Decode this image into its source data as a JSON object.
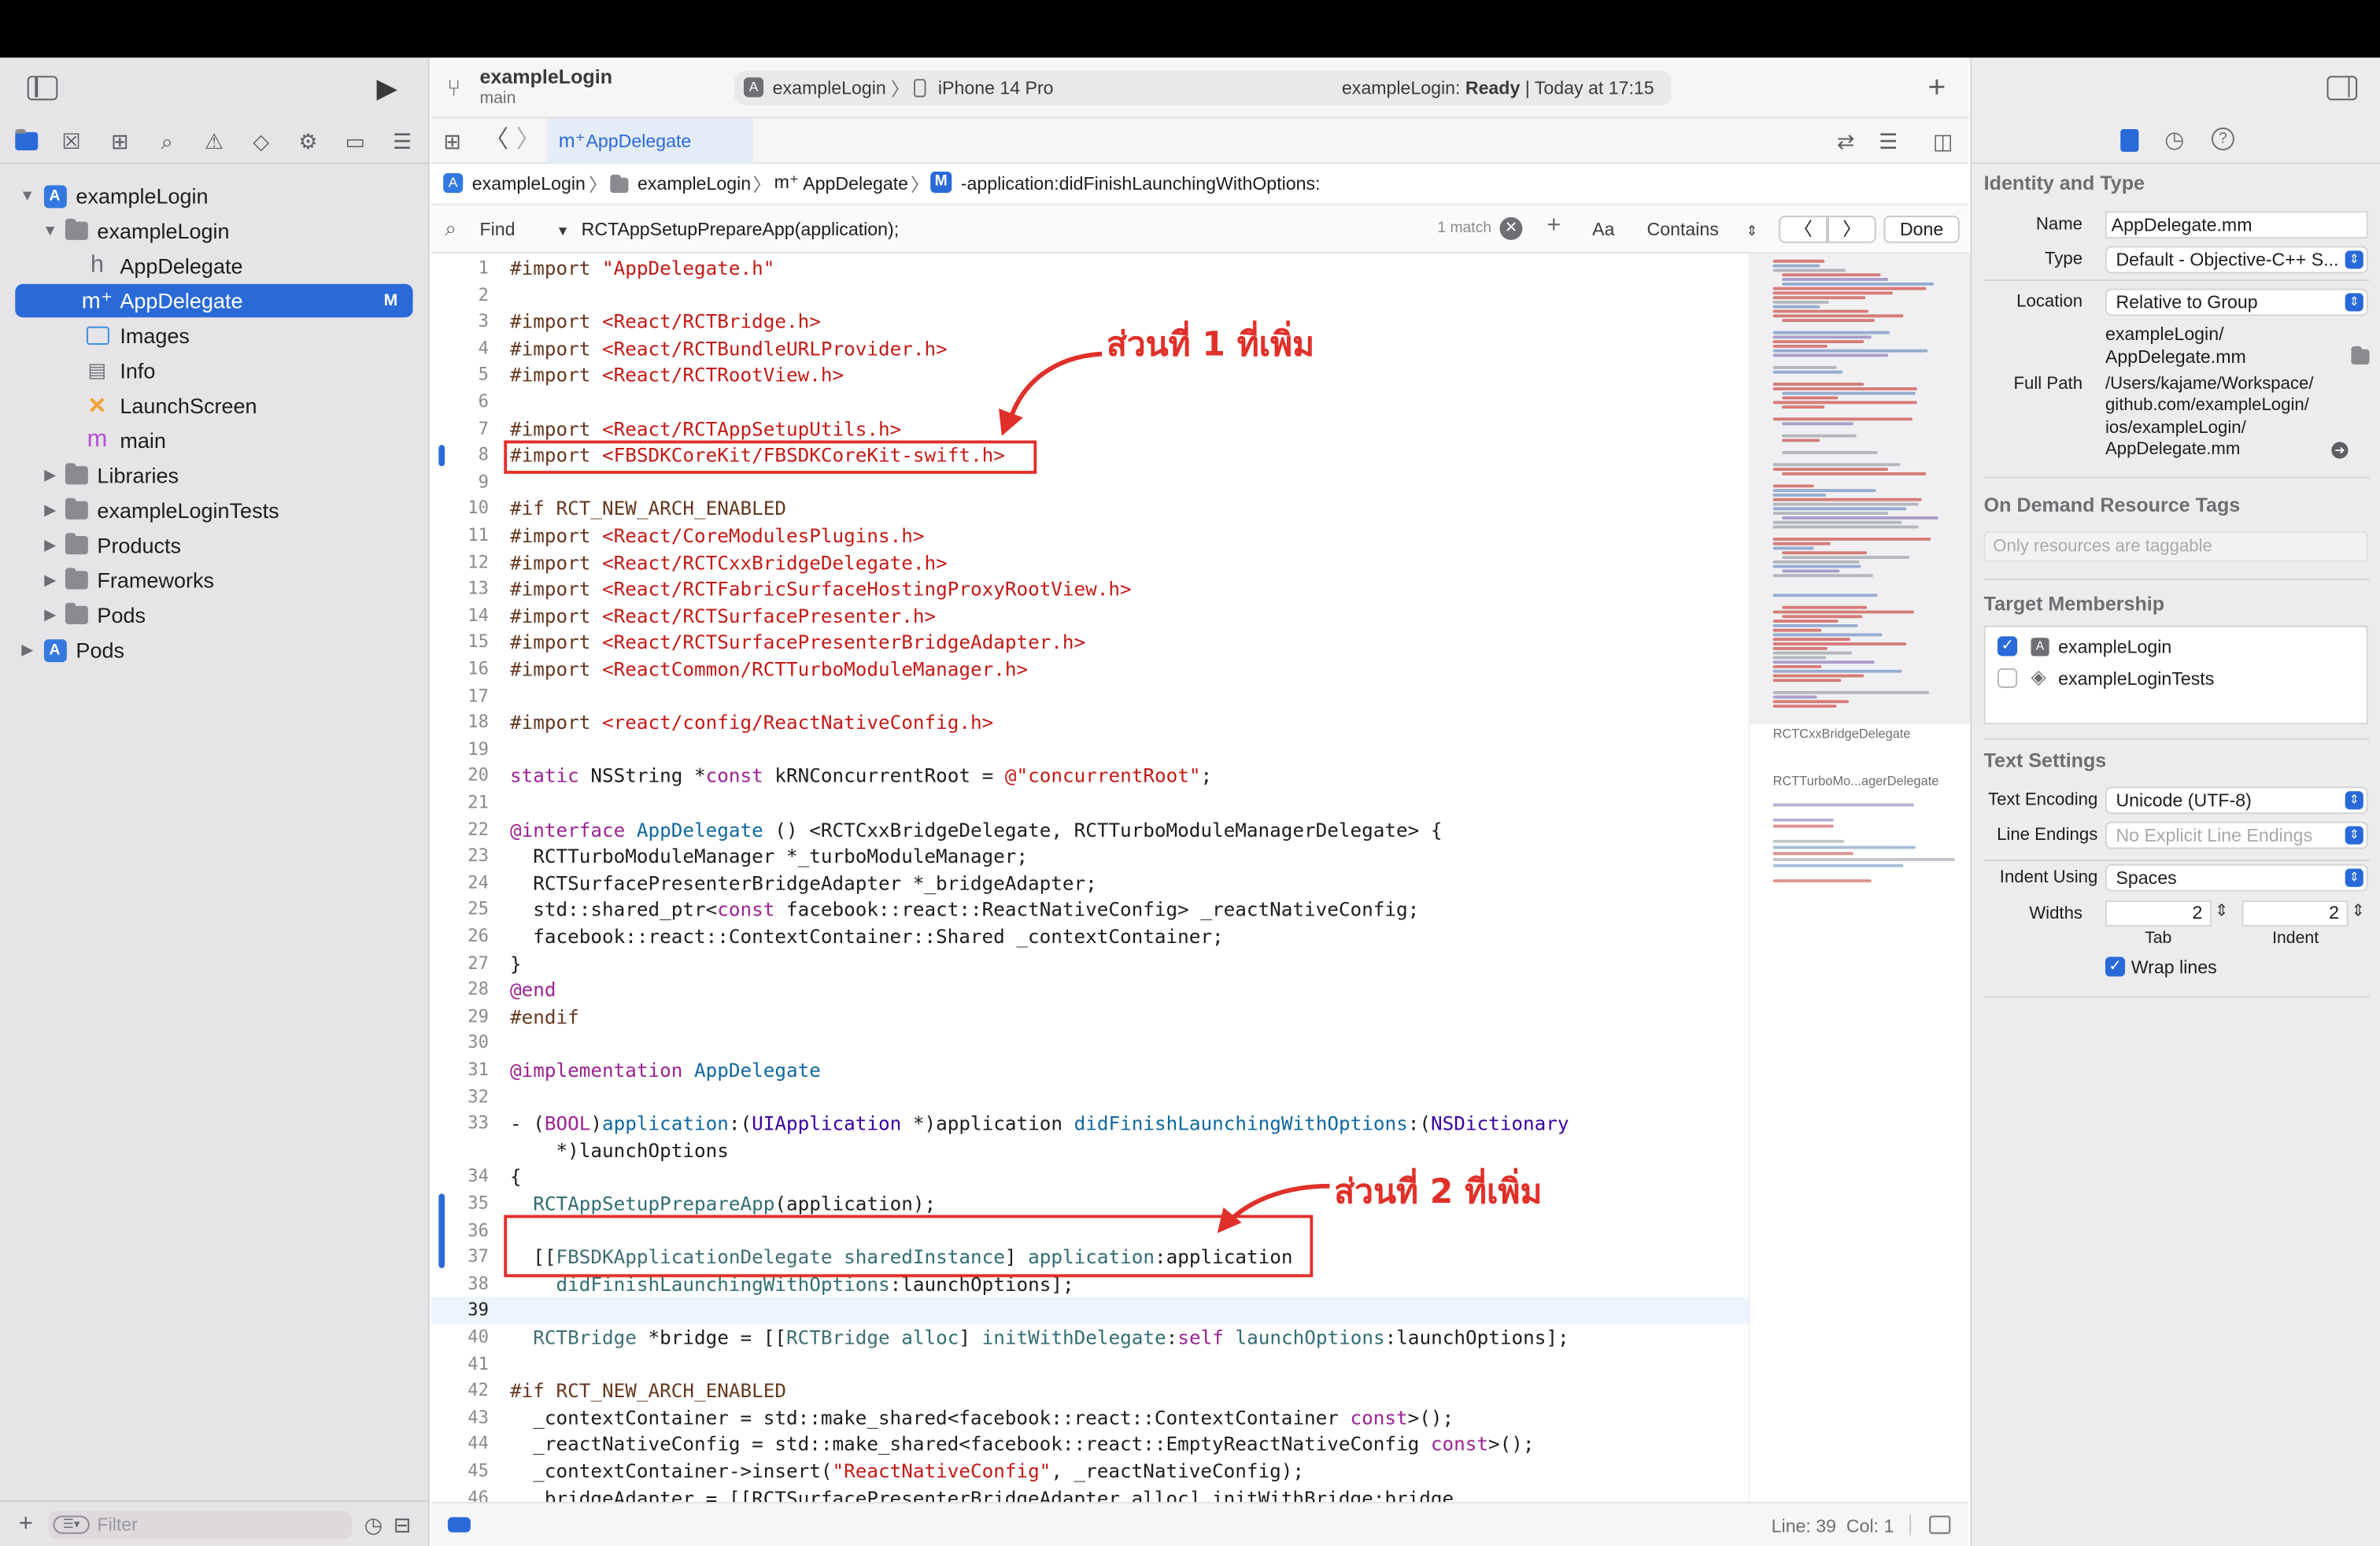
{
  "project": {
    "name": "exampleLogin",
    "branch": "main"
  },
  "toolbar": {
    "scheme": "exampleLogin",
    "device": "iPhone 14 Pro",
    "status_prefix": "exampleLogin: ",
    "status_state": "Ready",
    "status_time": " | Today at 17:15"
  },
  "navigator": {
    "items": [
      {
        "label": "exampleLogin",
        "kind": "project"
      },
      {
        "label": "exampleLogin",
        "kind": "folder"
      },
      {
        "label": "AppDelegate",
        "kind": "header-file",
        "icon_glyph": "h"
      },
      {
        "label": "AppDelegate",
        "kind": "objc-file",
        "icon_glyph": "m⁺",
        "badge": "M"
      },
      {
        "label": "Images",
        "kind": "assets"
      },
      {
        "label": "Info",
        "kind": "plist"
      },
      {
        "label": "LaunchScreen",
        "kind": "storyboard",
        "icon_glyph": "✕"
      },
      {
        "label": "main",
        "kind": "objc-file",
        "icon_glyph": "m"
      },
      {
        "label": "Libraries",
        "kind": "folder"
      },
      {
        "label": "exampleLoginTests",
        "kind": "folder"
      },
      {
        "label": "Products",
        "kind": "folder"
      },
      {
        "label": "Frameworks",
        "kind": "folder"
      },
      {
        "label": "Pods",
        "kind": "folder"
      },
      {
        "label": "Pods",
        "kind": "project"
      }
    ],
    "filter_placeholder": "Filter"
  },
  "tab": {
    "label": "AppDelegate"
  },
  "jumpbar": {
    "items": [
      "exampleLogin",
      "exampleLogin",
      "AppDelegate",
      "-application:didFinishLaunchingWithOptions:"
    ]
  },
  "find": {
    "mode": "Find",
    "query": "RCTAppSetupPrepareApp(application);",
    "matches": "1 match",
    "case_label": "Aa",
    "match_mode": "Contains",
    "done_label": "Done"
  },
  "code": {
    "lines": [
      {
        "n": "1",
        "html": "<span class='p'>#import</span> <span class='s'>\"AppDelegate.h\"</span>"
      },
      {
        "n": "2",
        "html": ""
      },
      {
        "n": "3",
        "html": "<span class='p'>#import</span> <span class='s'>&lt;React/RCTBridge.h&gt;</span>"
      },
      {
        "n": "4",
        "html": "<span class='p'>#import</span> <span class='s'>&lt;React/RCTBundleURLProvider.h&gt;</span>"
      },
      {
        "n": "5",
        "html": "<span class='p'>#import</span> <span class='s'>&lt;React/RCTRootView.h&gt;</span>"
      },
      {
        "n": "6",
        "html": ""
      },
      {
        "n": "7",
        "html": "<span class='p'>#import</span> <span class='s'>&lt;React/RCTAppSetupUtils.h&gt;</span>"
      },
      {
        "n": "8",
        "html": "<span class='p'>#import</span> <span class='s'>&lt;FBSDKCoreKit/FBSDKCoreKit-swift.h&gt;</span>"
      },
      {
        "n": "9",
        "html": ""
      },
      {
        "n": "10",
        "html": "<span class='p'>#if RCT_NEW_ARCH_ENABLED</span>"
      },
      {
        "n": "11",
        "html": "<span class='p'>#import</span> <span class='s'>&lt;React/CoreModulesPlugins.h&gt;</span>"
      },
      {
        "n": "12",
        "html": "<span class='p'>#import</span> <span class='s'>&lt;React/RCTCxxBridgeDelegate.h&gt;</span>"
      },
      {
        "n": "13",
        "html": "<span class='p'>#import</span> <span class='s'>&lt;React/RCTFabricSurfaceHostingProxyRootView.h&gt;</span>"
      },
      {
        "n": "14",
        "html": "<span class='p'>#import</span> <span class='s'>&lt;React/RCTSurfacePresenter.h&gt;</span>"
      },
      {
        "n": "15",
        "html": "<span class='p'>#import</span> <span class='s'>&lt;React/RCTSurfacePresenterBridgeAdapter.h&gt;</span>"
      },
      {
        "n": "16",
        "html": "<span class='p'>#import</span> <span class='s'>&lt;ReactCommon/RCTTurboModuleManager.h&gt;</span>"
      },
      {
        "n": "17",
        "html": ""
      },
      {
        "n": "18",
        "html": "<span class='p'>#import</span> <span class='s'>&lt;react/config/ReactNativeConfig.h&gt;</span>"
      },
      {
        "n": "19",
        "html": ""
      },
      {
        "n": "20",
        "html": "<span class='k'>static</span> NSString *<span class='k'>const</span> kRNConcurrentRoot = <span class='s'>@\"concurrentRoot\"</span>;"
      },
      {
        "n": "21",
        "html": ""
      },
      {
        "n": "22",
        "html": "<span class='k'>@interface</span> <span class='f'>AppDelegate</span> () &lt;RCTCxxBridgeDelegate, RCTTurboModuleManagerDelegate&gt; {"
      },
      {
        "n": "23",
        "html": "  RCTTurboModuleManager *_turboModuleManager;"
      },
      {
        "n": "24",
        "html": "  RCTSurfacePresenterBridgeAdapter *_bridgeAdapter;"
      },
      {
        "n": "25",
        "html": "  std::shared_ptr&lt;<span class='k'>const</span> facebook::react::ReactNativeConfig&gt; _reactNativeConfig;"
      },
      {
        "n": "26",
        "html": "  facebook::react::ContextContainer::Shared _contextContainer;"
      },
      {
        "n": "27",
        "html": "}"
      },
      {
        "n": "28",
        "html": "<span class='k'>@end</span>"
      },
      {
        "n": "29",
        "html": "<span class='p'>#endif</span>"
      },
      {
        "n": "30",
        "html": ""
      },
      {
        "n": "31",
        "html": "<span class='k'>@implementation</span> <span class='f'>AppDelegate</span>"
      },
      {
        "n": "32",
        "html": ""
      },
      {
        "n": "33",
        "html": "- (<span class='k'>BOOL</span>)<span class='f'>application</span>:(<span class='b'>UIApplication</span> *)application <span class='f'>didFinishLaunchingWithOptions</span>:(<span class='b'>NSDictionary</span>"
      },
      {
        "n": "",
        "html": "    *)launchOptions"
      },
      {
        "n": "34",
        "html": "{"
      },
      {
        "n": "35",
        "html": "  <span class='m'>RCTAppSetupPrepareApp</span>(application);"
      },
      {
        "n": "36",
        "html": ""
      },
      {
        "n": "37",
        "html": "  [[<span class='t'>FBSDKApplicationDelegate</span> <span class='m'>sharedInstance</span>] <span class='m'>application</span>:application"
      },
      {
        "n": "38",
        "html": "    <span class='m'>didFinishLaunchingWithOptions</span>:launchOptions];"
      },
      {
        "n": "39",
        "html": ""
      },
      {
        "n": "40",
        "html": "  <span class='t'>RCTBridge</span> *bridge = [[<span class='t'>RCTBridge</span> <span class='m'>alloc</span>] <span class='m'>initWithDelegate</span>:<span class='k'>self</span> <span class='m'>launchOptions</span>:launchOptions];"
      },
      {
        "n": "41",
        "html": ""
      },
      {
        "n": "42",
        "html": "<span class='p'>#if RCT_NEW_ARCH_ENABLED</span>"
      },
      {
        "n": "43",
        "html": "  _contextContainer = std::make_shared&lt;facebook::react::ContextContainer <span class='k'>const</span>&gt;();"
      },
      {
        "n": "44",
        "html": "  _reactNativeConfig = std::make_shared&lt;facebook::react::EmptyReactNativeConfig <span class='k'>const</span>&gt;();"
      },
      {
        "n": "45",
        "html": "  _contextContainer-&gt;insert(<span class='s'>\"ReactNativeConfig\"</span>, _reactNativeConfig);"
      },
      {
        "n": "46",
        "html": "  _bridgeAdapter = [[RCTSurfacePresenterBridgeAdapter alloc] initWithBridge:bridge"
      }
    ]
  },
  "annotations": {
    "first": "ส่วนที่ 1 ที่เพิ่ม",
    "second": "ส่วนที่ 2 ที่เพิ่ม"
  },
  "minimap": {
    "label1": "RCTCxxBridgeDelegate",
    "label2": "RCTTurboMo...agerDelegate"
  },
  "status": {
    "position": "Line: 39  Col: 1"
  },
  "inspector": {
    "identity_header": "Identity and Type",
    "name_label": "Name",
    "name_value": "AppDelegate.mm",
    "type_label": "Type",
    "type_value": "Default - Objective-C++ S...",
    "location_label": "Location",
    "location_value": "Relative to Group",
    "location_path": [
      "exampleLogin/",
      "AppDelegate.mm"
    ],
    "fullpath_label": "Full Path",
    "fullpath_value": [
      "/Users/kajame/Workspace/",
      "github.com/exampleLogin/",
      "ios/exampleLogin/",
      "AppDelegate.mm"
    ],
    "tags_header": "On Demand Resource Tags",
    "tags_placeholder": "Only resources are taggable",
    "membership_header": "Target Membership",
    "targets": [
      {
        "label": "exampleLogin",
        "checked": true
      },
      {
        "label": "exampleLoginTests",
        "checked": false
      }
    ],
    "text_header": "Text Settings",
    "encoding_label": "Text Encoding",
    "encoding_value": "Unicode (UTF-8)",
    "endings_label": "Line Endings",
    "endings_value": "No Explicit Line Endings",
    "indent_label": "Indent Using",
    "indent_value": "Spaces",
    "widths_label": "Widths",
    "tab_width": "2",
    "indent_width": "2",
    "tab_caption": "Tab",
    "indent_caption": "Indent",
    "wrap_label": "Wrap lines",
    "wrap_checked": true
  },
  "colors": {
    "accent": "#2a6ad8",
    "annotation": "#e0302a"
  }
}
